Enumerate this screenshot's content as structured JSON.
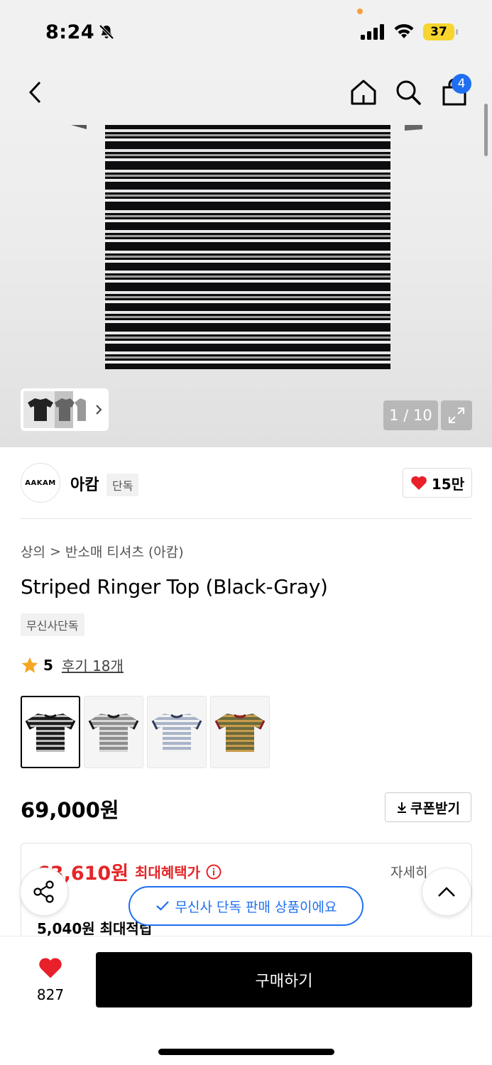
{
  "status": {
    "time": "8:24",
    "battery": "37"
  },
  "nav": {
    "cart_count": "4"
  },
  "hero": {
    "pager": "1 / 10"
  },
  "brand": {
    "logo_text": "AAKAM",
    "name": "아캄",
    "tag": "단독",
    "likes": "15만"
  },
  "breadcrumb": {
    "level1": "상의",
    "separator": ">",
    "level2": "반소매 티셔츠 (아캄)"
  },
  "product": {
    "title": "Striped Ringer Top (Black-Gray)",
    "exclusive_tag": "무신사단독",
    "rating_score": "5",
    "reviews": "후기 18개",
    "price": "69,000원",
    "coupon_label": "쿠폰받기"
  },
  "variants": [
    {
      "body": "#1d1d1d",
      "stripe": "#bdbdbd",
      "trim": "#111111"
    },
    {
      "body": "#8d8d8d",
      "stripe": "#d8d8d8",
      "trim": "#1a1a1a"
    },
    {
      "body": "#a9b3c8",
      "stripe": "#f2f2f2",
      "trim": "#2d3a58"
    },
    {
      "body": "#6b6a3c",
      "stripe": "#c89b4a",
      "trim": "#8b1d2a"
    }
  ],
  "benefit": {
    "price": "63,610원",
    "label": "최대혜택가",
    "detail": "자세히",
    "points": "5,040원 최대적립"
  },
  "toast": {
    "text": "무신사 단독 판매 상품이에요"
  },
  "bottom": {
    "wish_count": "827",
    "buy_label": "구매하기"
  },
  "colors": {
    "accent_blue": "#1e6ff1",
    "sale_red": "#e52528",
    "heart_red": "#e8202a"
  }
}
